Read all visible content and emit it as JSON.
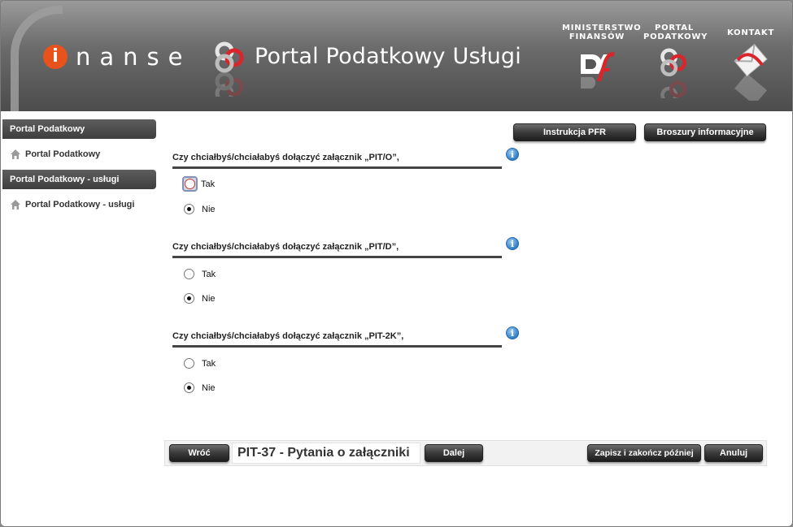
{
  "header": {
    "logo_letter": "i",
    "logo_rest": "nanse",
    "portal_title": "Portal Podatkowy Usługi",
    "links": [
      {
        "label": "MINISTERSTWO\nFINANSÓW",
        "icon": "mf-logo-icon"
      },
      {
        "label": "PORTAL\nPODATKOWY",
        "icon": "portal-logo-icon"
      },
      {
        "label": "KONTAKT",
        "icon": "envelope-icon"
      }
    ]
  },
  "sidebar": {
    "sections": [
      {
        "heading": "Portal Podatkowy",
        "item": "Portal Podatkowy"
      },
      {
        "heading": "Portal Podatkowy - usługi",
        "item": "Portal Podatkowy - usługi"
      }
    ]
  },
  "toolbar": {
    "instrukcja": "Instrukcja PFR",
    "broszury": "Broszury informacyjne"
  },
  "questions": [
    {
      "text": "Czy chciałbyś/chciałabyś dołączyć załącznik „PIT/O”,",
      "yes": "Tak",
      "no": "Nie",
      "selected": "no",
      "focused": "yes"
    },
    {
      "text": "Czy chciałbyś/chciałabyś dołączyć załącznik „PIT/D”,",
      "yes": "Tak",
      "no": "Nie",
      "selected": "no"
    },
    {
      "text": "Czy chciałbyś/chciałabyś dołączyć załącznik „PIT-2K”,",
      "yes": "Tak",
      "no": "Nie",
      "selected": "no"
    }
  ],
  "info_icon_glyph": "i",
  "bottom": {
    "wroc": "Wróć",
    "page_title": "PIT-37 - Pytania o załączniki",
    "dalej": "Dalej",
    "zapisz": "Zapisz i zakończ później",
    "anuluj": "Anuluj"
  },
  "colors": {
    "accent_orange": "#e8521c",
    "portal_red": "#d9262c",
    "button_dark": "#2e2e2e",
    "info_blue": "#2f7dc7"
  }
}
